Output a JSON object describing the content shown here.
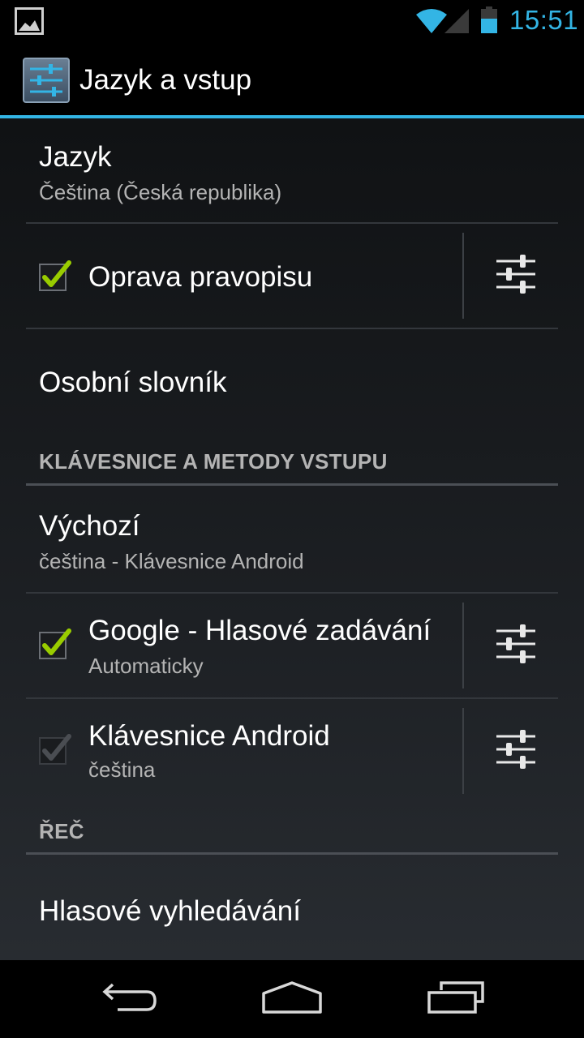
{
  "status_bar": {
    "time": "15:51",
    "icons": [
      "picture-notification-icon",
      "wifi-icon",
      "signal-icon",
      "battery-icon"
    ],
    "accent_color": "#33b5e5"
  },
  "action_bar": {
    "title": "Jazyk a vstup",
    "icon": "settings-sliders-icon"
  },
  "settings": {
    "language": {
      "title": "Jazyk",
      "summary": "Čeština (Česká republika)"
    },
    "spellcheck": {
      "title": "Oprava pravopisu",
      "checked": true,
      "enabled": true
    },
    "personal_dictionary": {
      "title": "Osobní slovník"
    },
    "keyboards_header": "KLÁVESNICE A METODY VSTUPU",
    "default_input": {
      "title": "Výchozí",
      "summary": "čeština - Klávesnice Android"
    },
    "google_voice": {
      "title": "Google - Hlasové zadávání",
      "summary": "Automaticky",
      "checked": true,
      "enabled": true
    },
    "android_keyboard": {
      "title": "Klávesnice Android",
      "summary": "čeština",
      "checked": true,
      "enabled": false
    },
    "speech_header": "ŘEČ",
    "voice_search": {
      "title": "Hlasové vyhledávání"
    }
  },
  "nav_bar": {
    "buttons": [
      "back-icon",
      "home-icon",
      "recent-apps-icon"
    ]
  }
}
